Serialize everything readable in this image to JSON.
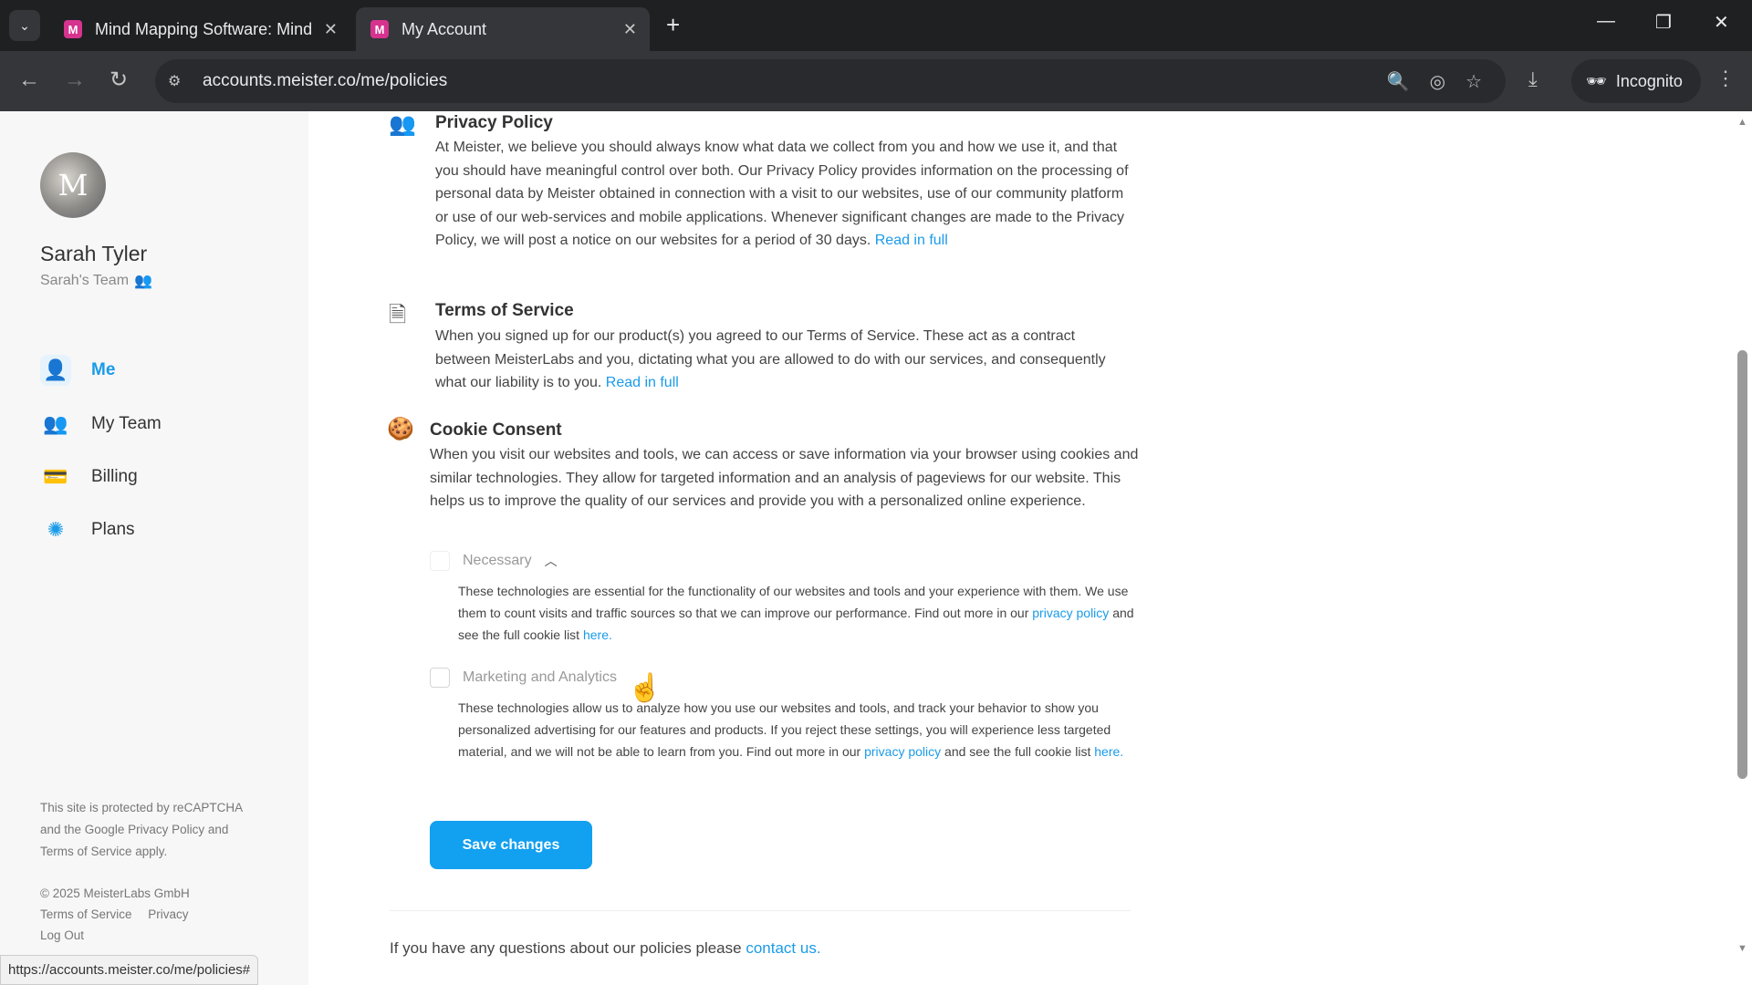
{
  "browser": {
    "tabs": [
      {
        "title": "Mind Mapping Software: Mind",
        "favicon": "M"
      },
      {
        "title": "My Account",
        "favicon": "M"
      }
    ],
    "url": "accounts.meister.co/me/policies",
    "incognito_label": "Incognito",
    "status_url": "https://accounts.meister.co/me/policies#"
  },
  "sidebar": {
    "user_name": "Sarah Tyler",
    "team_name": "Sarah's Team",
    "nav": [
      {
        "label": "Me",
        "icon": "me-icon"
      },
      {
        "label": "My Team",
        "icon": "team-icon"
      },
      {
        "label": "Billing",
        "icon": "billing-icon"
      },
      {
        "label": "Plans",
        "icon": "plans-icon"
      }
    ],
    "recaptcha_lines": [
      "This site is protected by reCAPTCHA",
      "and the Google Privacy Policy and",
      "Terms of Service apply."
    ],
    "copyright": "© 2025 MeisterLabs GmbH",
    "footer_links": [
      "Terms of Service",
      "Privacy"
    ],
    "logout": "Log Out"
  },
  "policies": {
    "privacy": {
      "title": "Privacy Policy",
      "body": "At Meister, we believe you should always know what data we collect from you and how we use it, and that you should have meaningful control over both. Our Privacy Policy provides information on the processing of personal data by Meister obtained in connection with a visit to our websites, use of our community platform or use of our web-services and mobile applications. Whenever significant changes are made to the Privacy Policy, we will post a notice on our websites for a period of 30 days.",
      "link": "Read in full"
    },
    "terms": {
      "title": "Terms of Service",
      "body": "When you signed up for our product(s) you agreed to our Terms of Service. These act as a contract between MeisterLabs and you, dictating what you are allowed to do with our services, and consequently what our liability is to you.",
      "link": "Read in full"
    },
    "cookies": {
      "title": "Cookie Consent",
      "body": "When you visit our websites and tools, we can access or save information via your browser using cookies and similar technologies. They allow for targeted information and an analysis of pageviews for our website. This helps us to improve the quality of our services and provide you with a personalized online experience.",
      "necessary": {
        "label": "Necessary",
        "text": "These technologies are essential for the functionality of our websites and tools and your experience with them. We use them to count visits and traffic sources so that we can improve our performance. Find out more in our",
        "link1": "privacy policy",
        "mid": "and see the full cookie list",
        "link2": "here."
      },
      "marketing": {
        "label": "Marketing and Analytics",
        "text": "These technologies allow us to analyze how you use our websites and tools, and track your behavior to show you personalized advertising for our features and products. If you reject these settings, you will experience less targeted material, and we will not be able to learn from you. Find out more in our",
        "link1": "privacy policy",
        "mid": "and see the full cookie list",
        "link2": "here."
      }
    },
    "save_label": "Save changes",
    "questions_text": "If you have any questions about our policies please",
    "contact_link": "contact us."
  }
}
